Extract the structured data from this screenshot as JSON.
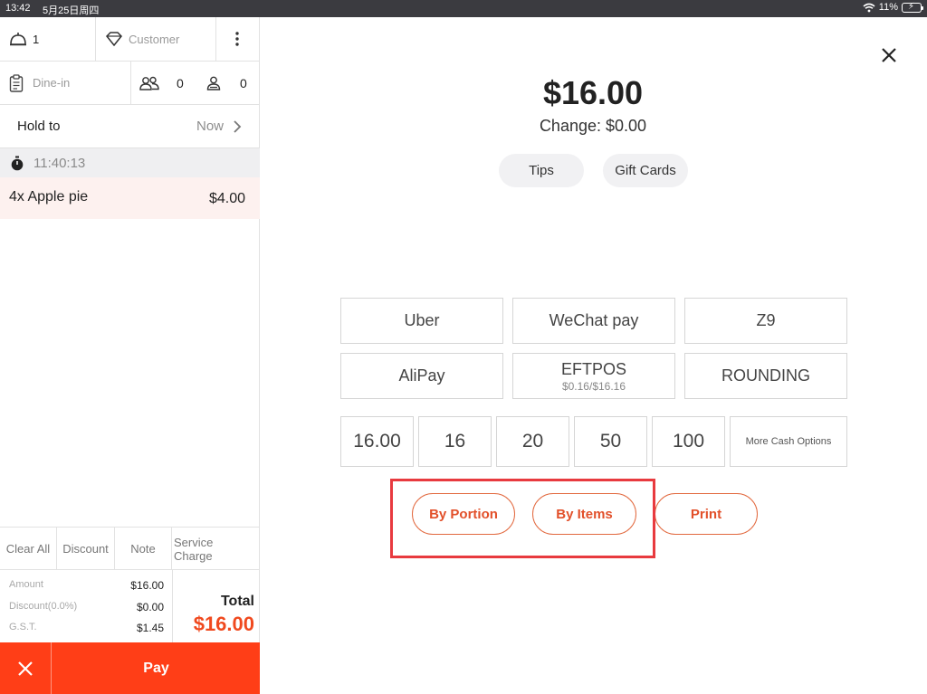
{
  "status_bar": {
    "time": "13:42",
    "date": "5月25日周四",
    "battery": "11%"
  },
  "order_panel": {
    "table_number": "1",
    "customer_placeholder": "Customer",
    "order_type": "Dine-in",
    "guest_count": "0",
    "person_count": "0",
    "hold_label": "Hold to",
    "hold_value": "Now",
    "timestamp": "11:40:13",
    "items": [
      {
        "name": "4x Apple pie",
        "price": "$4.00"
      }
    ],
    "actions": {
      "clear_all": "Clear All",
      "discount": "Discount",
      "note": "Note",
      "service_charge": "Service Charge"
    },
    "summary": {
      "amount_label": "Amount",
      "amount_value": "$16.00",
      "discount_label": "Discount(0.0%)",
      "discount_value": "$0.00",
      "gst_label": "G.S.T.",
      "gst_value": "$1.45",
      "total_label": "Total",
      "total_value": "$16.00"
    },
    "pay_label": "Pay"
  },
  "payment_panel": {
    "amount": "$16.00",
    "change": "Change: $0.00",
    "tips_label": "Tips",
    "gift_cards_label": "Gift Cards",
    "methods": [
      {
        "label": "Uber"
      },
      {
        "label": "WeChat pay"
      },
      {
        "label": "Z9"
      },
      {
        "label": "AliPay"
      },
      {
        "label": "EFTPOS",
        "sub": "$0.16/$16.16"
      },
      {
        "label": "ROUNDING"
      }
    ],
    "cash_options": [
      "16.00",
      "16",
      "20",
      "50",
      "100"
    ],
    "more_cash_label": "More Cash Options",
    "by_portion_label": "By Portion",
    "by_items_label": "By Items",
    "print_label": "Print"
  },
  "colors": {
    "accent": "#ff3e17",
    "total": "#f0491e",
    "outline": "#e2693f",
    "highlight": "#e83a3f"
  }
}
